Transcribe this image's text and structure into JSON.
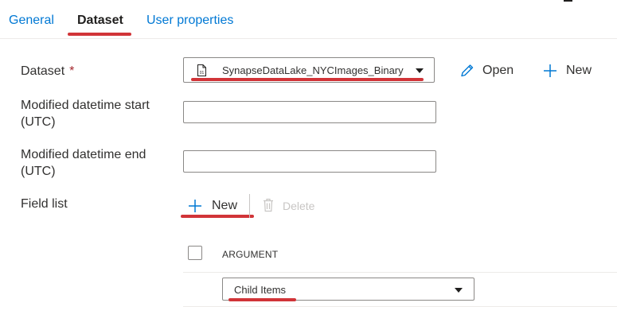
{
  "tabs": [
    {
      "label": "General"
    },
    {
      "label": "Dataset"
    },
    {
      "label": "User properties"
    }
  ],
  "active_tab": "Dataset",
  "form": {
    "dataset": {
      "label": "Dataset",
      "required_mark": "*",
      "selected": "SynapseDataLake_NYCImages_Binary",
      "icon": "binary-file-icon",
      "open_label": "Open",
      "new_label": "New"
    },
    "modified_start": {
      "label_line1": "Modified datetime start",
      "label_line2": "(UTC)",
      "value": ""
    },
    "modified_end": {
      "label_line1": "Modified datetime end",
      "label_line2": "(UTC)",
      "value": ""
    },
    "field_list": {
      "label": "Field list",
      "new_label": "New",
      "delete_label": "Delete",
      "column_header": "ARGUMENT",
      "rows": [
        {
          "argument": "Child Items"
        }
      ]
    }
  },
  "colors": {
    "accent": "#0078d4",
    "highlight": "#d13438",
    "required": "#a4262c",
    "disabled": "#c8c6c4"
  }
}
